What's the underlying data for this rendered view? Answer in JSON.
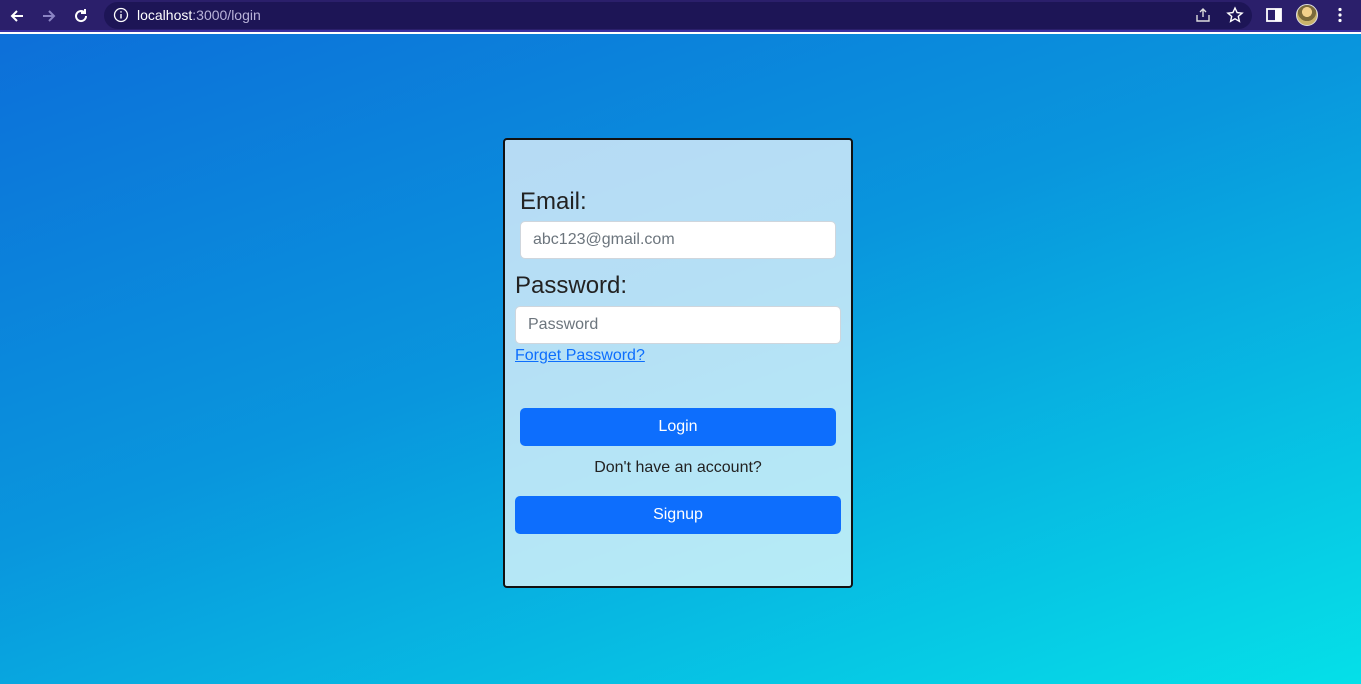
{
  "browser": {
    "url_host": "localhost",
    "url_path": ":3000/login"
  },
  "form": {
    "email_label": "Email:",
    "email_placeholder": "abc123@gmail.com",
    "password_label": "Password:",
    "password_placeholder": "Password",
    "forgot_link": "Forget Password?",
    "login_button": "Login",
    "signup_prompt": "Don't have an account?",
    "signup_button": "Signup"
  },
  "colors": {
    "primary": "#0d6efd",
    "chrome_bg": "#2b1f6b"
  }
}
